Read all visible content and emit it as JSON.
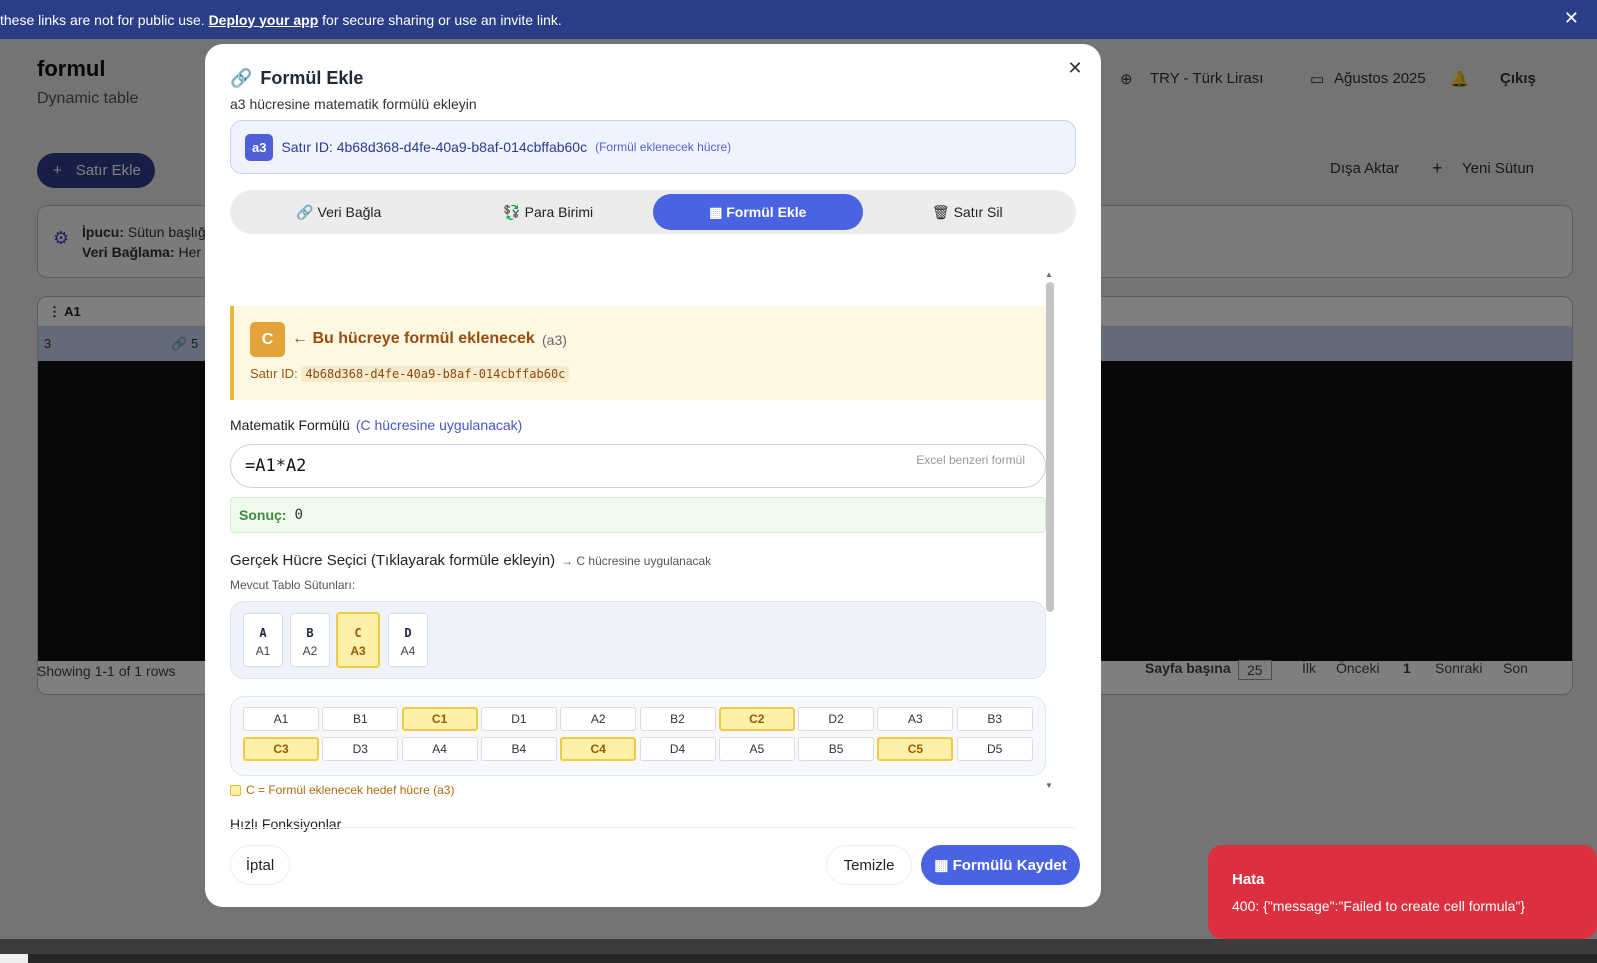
{
  "banner": {
    "prefix": "these links are not for public use. ",
    "link": "Deploy your app",
    "suffix": " for secure sharing or use an invite link.",
    "close_glyph": "✕"
  },
  "app": {
    "title": "formul",
    "subtitle": "Dynamic table",
    "currency": "TRY - Türk Lirası",
    "date": "Ağustos 2025",
    "logout": "Çıkış",
    "add_row": "Satır Ekle",
    "export": "Dışa Aktar",
    "new_column": "Yeni Sütun",
    "tip_label": "İpucu:",
    "tip_text": "Sütun başlığ",
    "tip2_label": "Veri Bağlama:",
    "tip2_text": "Her",
    "col_header": "A1",
    "row_value": "3",
    "row_value2": "5",
    "showing": "Showing 1-1 of 1 rows",
    "per_page_label": "Sayfa başına",
    "per_page": "25",
    "pager": [
      "İlk",
      "Önceki",
      "1",
      "Sonraki",
      "Son"
    ]
  },
  "modal": {
    "title": "Formül Ekle",
    "subtitle": "a3 hücresine matematik formülü ekleyin",
    "close_glyph": "✕",
    "cell_badge": "a3",
    "row_id_text": "Satır ID: 4b68d368-d4fe-40a9-b8af-014cbffab60c",
    "row_id_hint": "(Formül eklenecek hücre)",
    "tabs": [
      {
        "icon": "🔗",
        "label": "Veri Bağla"
      },
      {
        "icon": "💱",
        "label": "Para Birimi"
      },
      {
        "icon": "▦",
        "label": "Formül Ekle"
      },
      {
        "icon": "🗑",
        "label": "Satır Sil"
      }
    ],
    "target": {
      "badge": "C",
      "label": "← Bu hücreye formül eklenecek",
      "cell": "(a3)",
      "row_label": "Satır ID:",
      "row_id": "4b68d368-d4fe-40a9-b8af-014cbffab60c"
    },
    "formula_label": "Matematik Formülü",
    "formula_hint_label": "(C hücresine uygulanacak)",
    "formula_value": "=A1*A2",
    "formula_placeholder_hint": "Excel benzeri formül",
    "result_label": "Sonuç:",
    "result_value": "0",
    "selector_title": "Gerçek Hücre Seçici (Tıklayarak formüle ekleyin)",
    "selector_hint": "→ C hücresine uygulanacak",
    "columns_label": "Mevcut Tablo Sütunları:",
    "columns": [
      {
        "letter": "A",
        "ref": "A1",
        "selected": false
      },
      {
        "letter": "B",
        "ref": "A2",
        "selected": false
      },
      {
        "letter": "C",
        "ref": "A3",
        "selected": true
      },
      {
        "letter": "D",
        "ref": "A4",
        "selected": false
      }
    ],
    "grid_row1": [
      {
        "label": "A1",
        "sel": false
      },
      {
        "label": "B1",
        "sel": false
      },
      {
        "label": "C1",
        "sel": true
      },
      {
        "label": "D1",
        "sel": false
      },
      {
        "label": "A2",
        "sel": false
      },
      {
        "label": "B2",
        "sel": false
      },
      {
        "label": "C2",
        "sel": true
      },
      {
        "label": "D2",
        "sel": false
      },
      {
        "label": "A3",
        "sel": false
      },
      {
        "label": "B3",
        "sel": false
      }
    ],
    "grid_row2": [
      {
        "label": "C3",
        "sel": true
      },
      {
        "label": "D3",
        "sel": false
      },
      {
        "label": "A4",
        "sel": false
      },
      {
        "label": "B4",
        "sel": false
      },
      {
        "label": "C4",
        "sel": true
      },
      {
        "label": "D4",
        "sel": false
      },
      {
        "label": "A5",
        "sel": false
      },
      {
        "label": "B5",
        "sel": false
      },
      {
        "label": "C5",
        "sel": true
      },
      {
        "label": "D5",
        "sel": false
      }
    ],
    "legend": "C = Formül eklenecek hedef hücre (a3)",
    "quick_functions": "Hızlı Fonksiyonlar",
    "cancel": "İptal",
    "clear": "Temizle",
    "save_icon": "▦",
    "save": "Formülü Kaydet"
  },
  "toast": {
    "title": "Hata",
    "message": "400: {\"message\":\"Failed to create cell formula\"}"
  },
  "colors": {
    "primary": "#4a63e3",
    "error": "#dc2f3f",
    "target_yellow": "#fdf0a8",
    "banner": "#2b3d86"
  }
}
